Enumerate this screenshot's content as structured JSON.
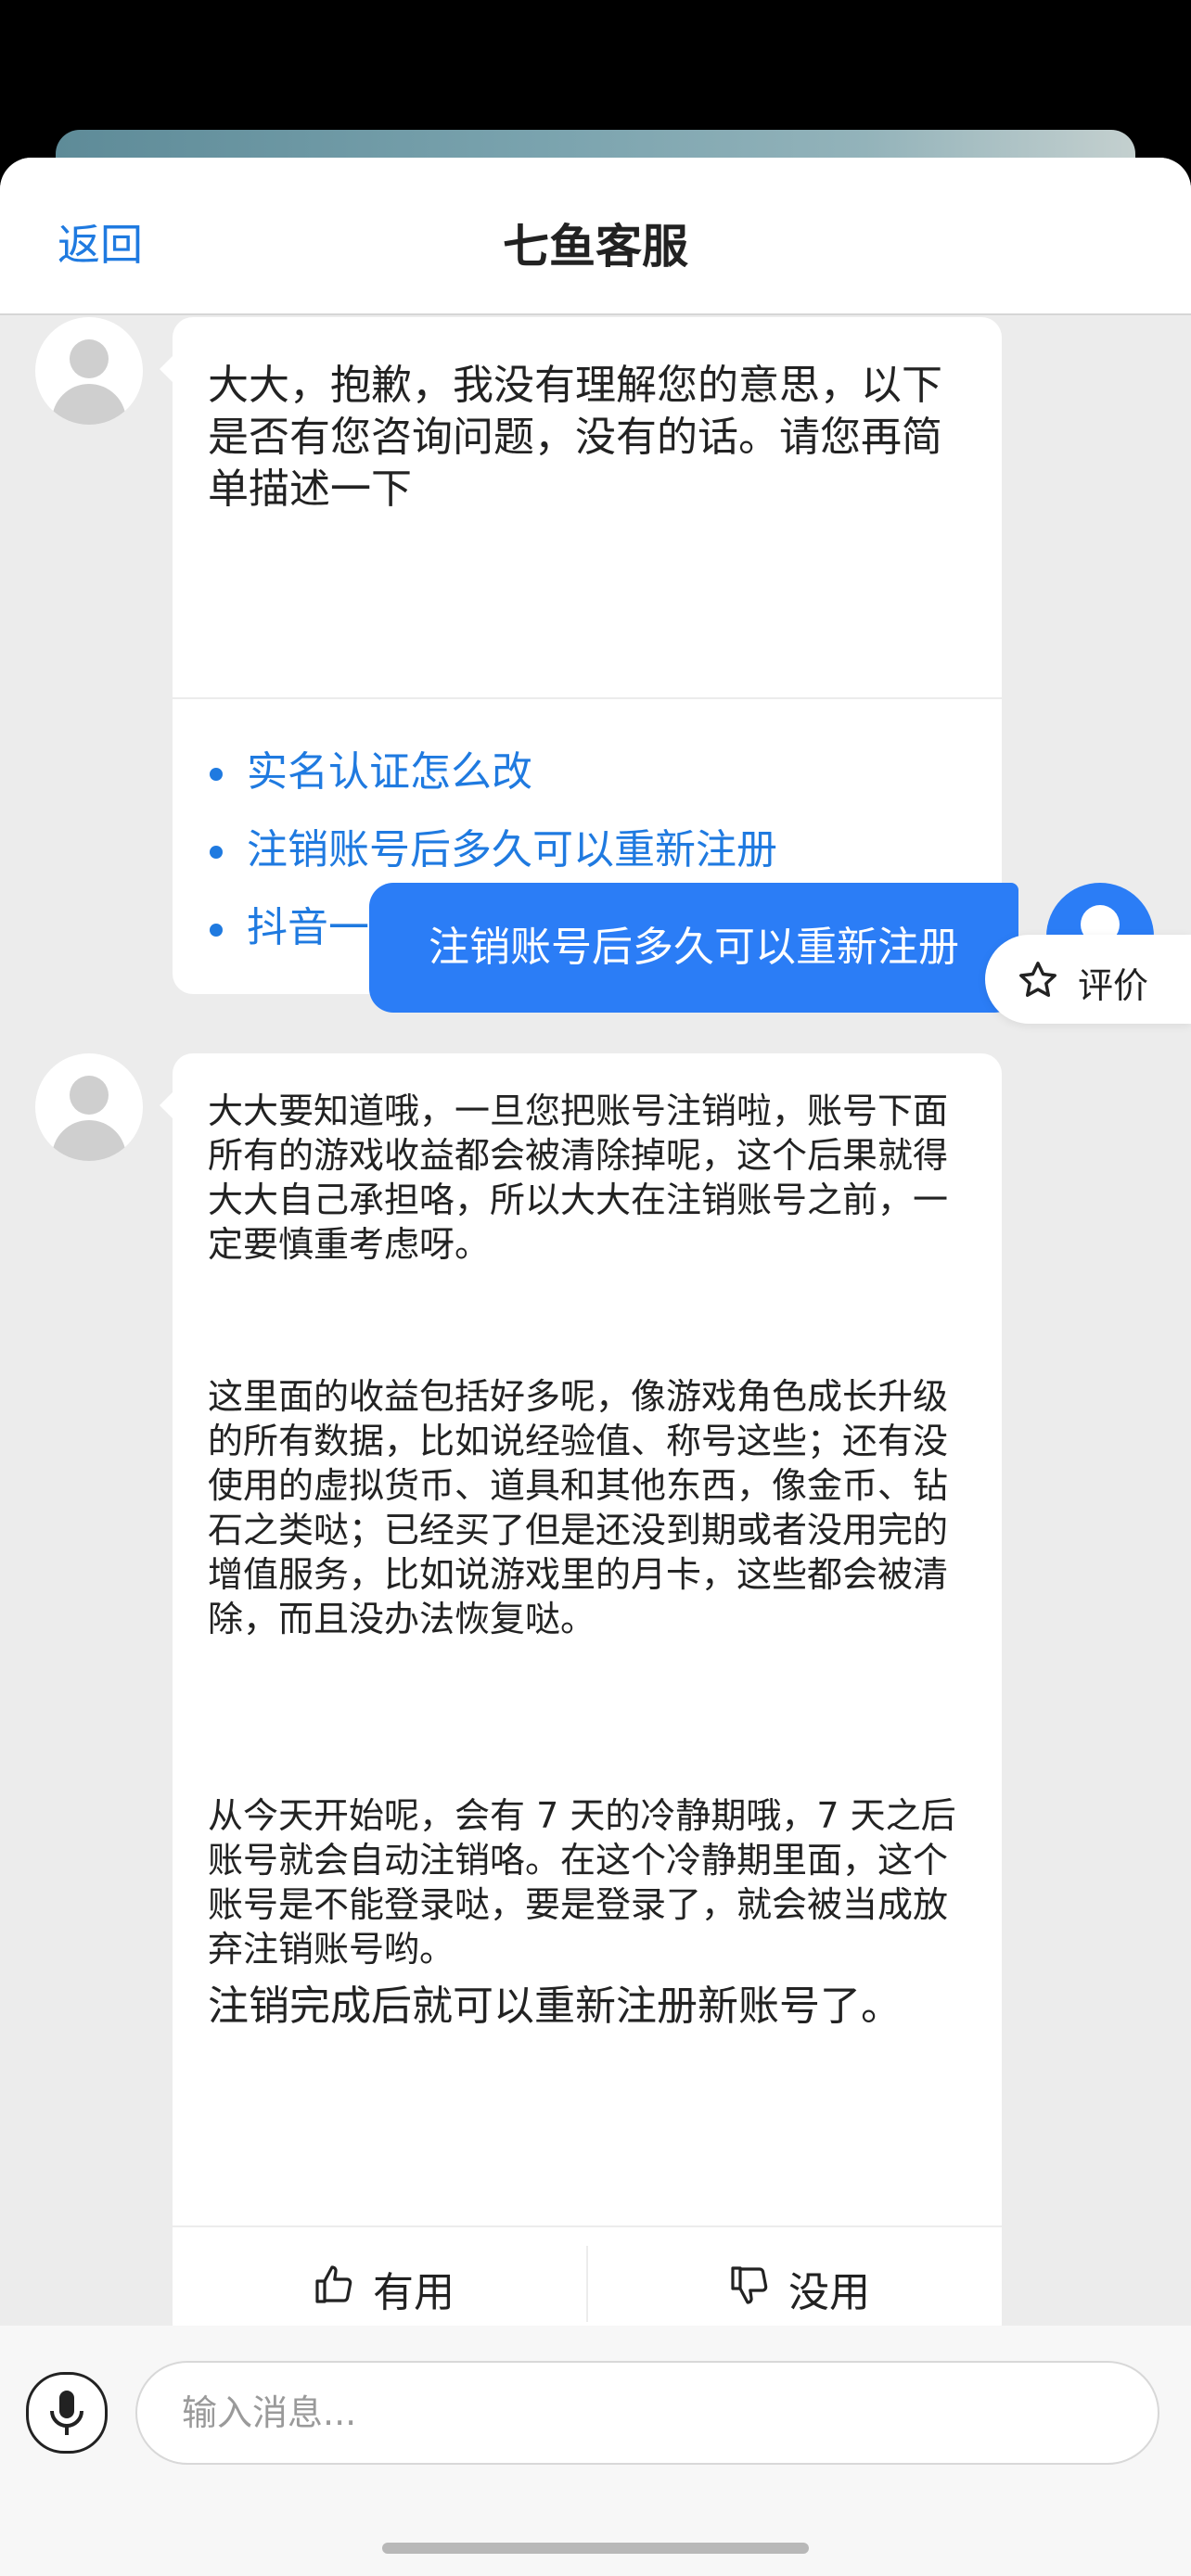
{
  "header": {
    "back_label": "返回",
    "title": "七鱼客服"
  },
  "bot_message_1": {
    "text": "大大，抱歉，我没有理解您的意思，以下是否有您咨询问题，没有的话。请您再简单描述一下",
    "suggestions": [
      {
        "label": "实名认证怎么改"
      },
      {
        "label": "注销账号后多久可以重新注册"
      },
      {
        "label": "抖音一键登录怎么没有了"
      }
    ]
  },
  "user_message": {
    "text": "注销账号后多久可以重新注册"
  },
  "rate_button": {
    "label": "评价",
    "icon": "star-outline-icon"
  },
  "bot_message_2": {
    "paragraphs": [
      "大大要知道哦，一旦您把账号注销啦，账号下面所有的游戏收益都会被清除掉呢，这个后果就得大大自己承担咯，所以大大在注销账号之前，一定要慎重考虑呀。",
      "这里面的收益包括好多呢，像游戏角色成长升级的所有数据，比如说经验值、称号这些；还有没使用的虚拟货币、道具和其他东西，像金币、钻石之类哒；已经买了但是还没到期或者没用完的增值服务，比如说游戏里的月卡，这些都会被清除，而且没办法恢复哒。",
      "从今天开始呢，会有 7 天的冷静期哦，7 天之后账号就会自动注销咯。在这个冷静期里面，这个账号是不能登录哒，要是登录了，就会被当成放弃注销账号哟。"
    ],
    "last_line": "注销完成后就可以重新注册新账号了。",
    "feedback": {
      "useful_label": "有用",
      "useless_label": "没用"
    }
  },
  "input": {
    "placeholder": "输入消息..."
  },
  "colors": {
    "accent": "#2b7df6",
    "link": "#1f7ae0",
    "background": "#ececec"
  }
}
